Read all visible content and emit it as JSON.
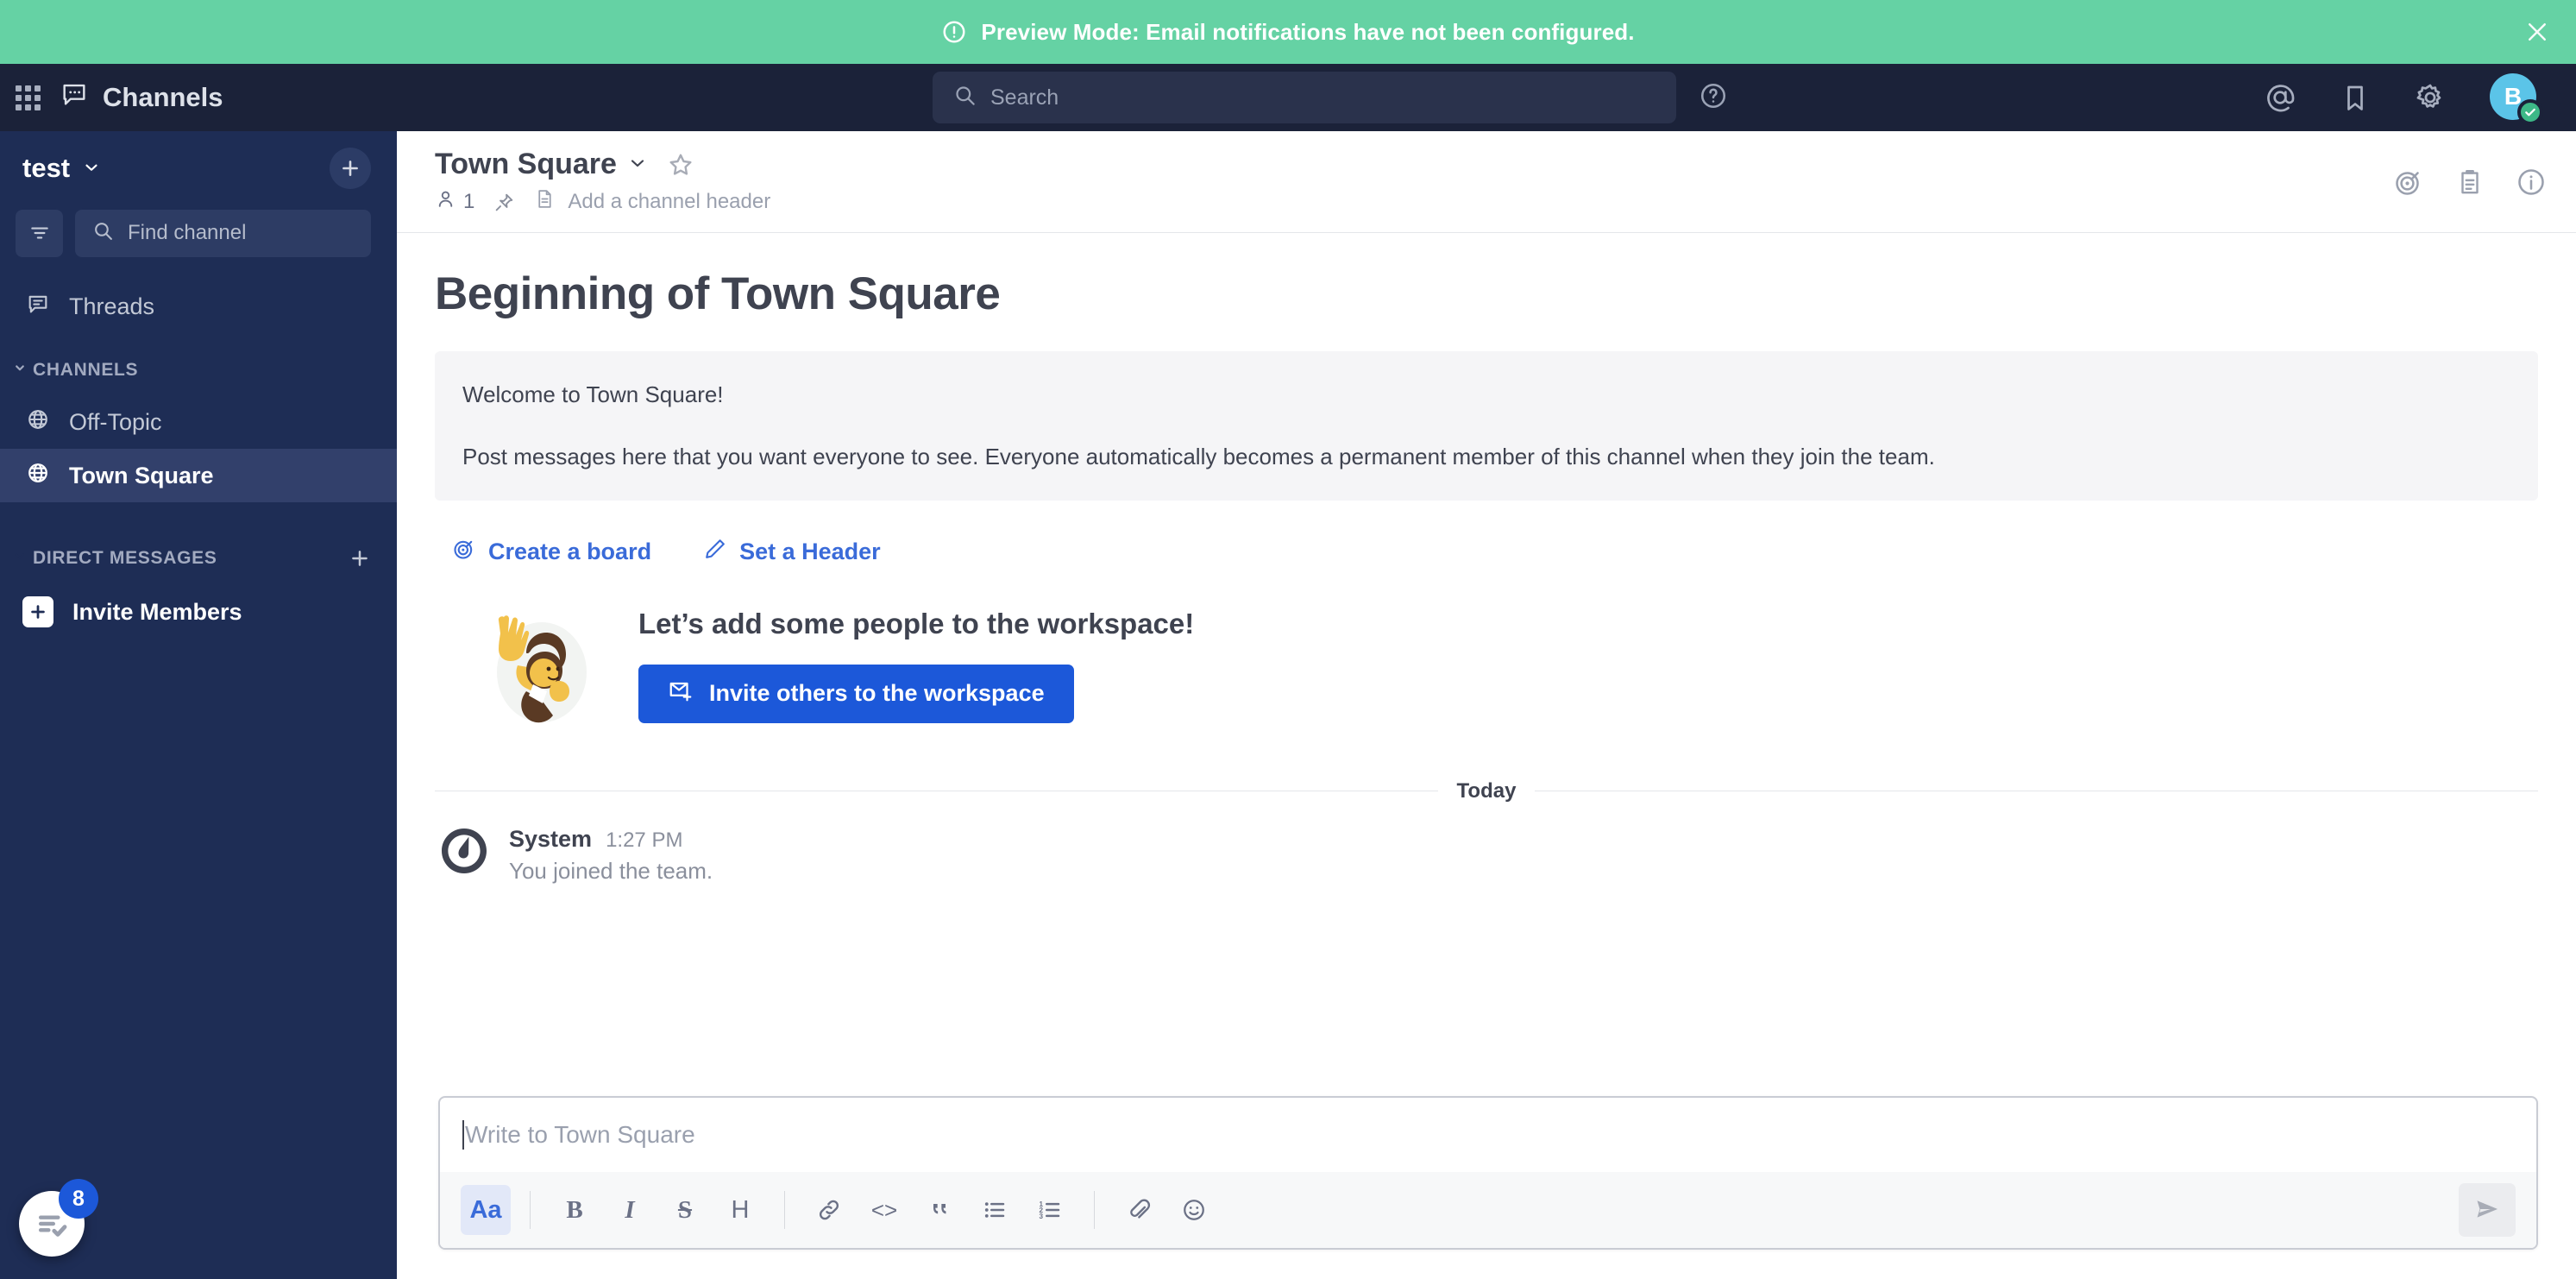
{
  "banner": {
    "text": "Preview Mode: Email notifications have not been configured.",
    "close_label": "×",
    "bg_color": "#65D2A4"
  },
  "global_header": {
    "product_menu_icon": "grid-icon",
    "product_name": "Channels",
    "search": {
      "placeholder": "Search",
      "value": ""
    },
    "help_icon": "question-circle-icon",
    "recent_mentions_icon": "at-mention-icon",
    "saved_posts_icon": "bookmark-icon",
    "settings_icon": "gear-icon",
    "avatar_initial": "B",
    "status": "online",
    "status_color": "#3DB887",
    "bg_color": "#1B2239"
  },
  "sidebar": {
    "team_name": "test",
    "browse_add_label": "+",
    "find_channel_placeholder": "Find channel",
    "filter_icon": "filter-icon",
    "threads_label": "Threads",
    "categories": [
      {
        "label": "CHANNELS",
        "channels": [
          {
            "name": "Off-Topic",
            "icon": "globe-icon",
            "active": false
          },
          {
            "name": "Town Square",
            "icon": "globe-icon",
            "active": true
          }
        ]
      },
      {
        "label": "DIRECT MESSAGES",
        "channels": []
      }
    ],
    "invite_members_label": "Invite Members",
    "task_badge_count": "8",
    "bg_color": "#1E2D55",
    "active_bg_color": "#32406B"
  },
  "channel_header": {
    "title": "Town Square",
    "favorite_icon": "star-outline-icon",
    "member_count": "1",
    "pinned_icon": "pin-icon",
    "file_icon": "file-icon",
    "add_header_label": "Add a channel header",
    "boards_icon": "boards-target-icon",
    "playbooks_icon": "playbooks-clipboard-icon",
    "info_icon": "info-circle-icon"
  },
  "intro": {
    "title": "Beginning of Town Square",
    "welcome_line": "Welcome to Town Square!",
    "purpose_line": "Post messages here that you want everyone to see. Everyone automatically becomes a permanent member of this channel when they join the team.",
    "actions": [
      {
        "label": "Create a board",
        "icon": "board-target-icon"
      },
      {
        "label": "Set a Header",
        "icon": "pencil-icon"
      }
    ],
    "invite": {
      "headline": "Let’s add some people to the workspace!",
      "cta_label": "Invite others to the workspace",
      "cta_icon": "envelope-plus-icon",
      "cta_color": "#1C58D9",
      "illustration": "person-waving-illustration"
    }
  },
  "posts": {
    "date_separator": "Today",
    "items": [
      {
        "author": "System",
        "timestamp": "1:27 PM",
        "message_prefix": "You ",
        "message": "joined the team.",
        "avatar": "mattermost-logo-icon"
      }
    ]
  },
  "composer": {
    "placeholder": "Write to Town Square",
    "value": "",
    "toolbar": [
      {
        "name": "formatting-toggle",
        "glyph": "Aa",
        "active": true
      },
      {
        "name": "bold",
        "glyph": "B",
        "active": false
      },
      {
        "name": "italic",
        "glyph": "I",
        "active": false
      },
      {
        "name": "strikethrough",
        "glyph": "S",
        "active": false
      },
      {
        "name": "heading",
        "glyph": "H",
        "active": false
      },
      {
        "name": "link",
        "glyph": "link-icon",
        "active": false
      },
      {
        "name": "code",
        "glyph": "<>",
        "active": false
      },
      {
        "name": "quote",
        "glyph": "“",
        "active": false
      },
      {
        "name": "bulleted-list",
        "glyph": "bullet-list-icon",
        "active": false
      },
      {
        "name": "ordered-list",
        "glyph": "ordered-list-icon",
        "active": false
      },
      {
        "name": "attachment",
        "glyph": "paperclip-icon",
        "active": false
      },
      {
        "name": "emoji",
        "glyph": "smiley-icon",
        "active": false
      }
    ],
    "send_icon": "send-plane-icon"
  }
}
